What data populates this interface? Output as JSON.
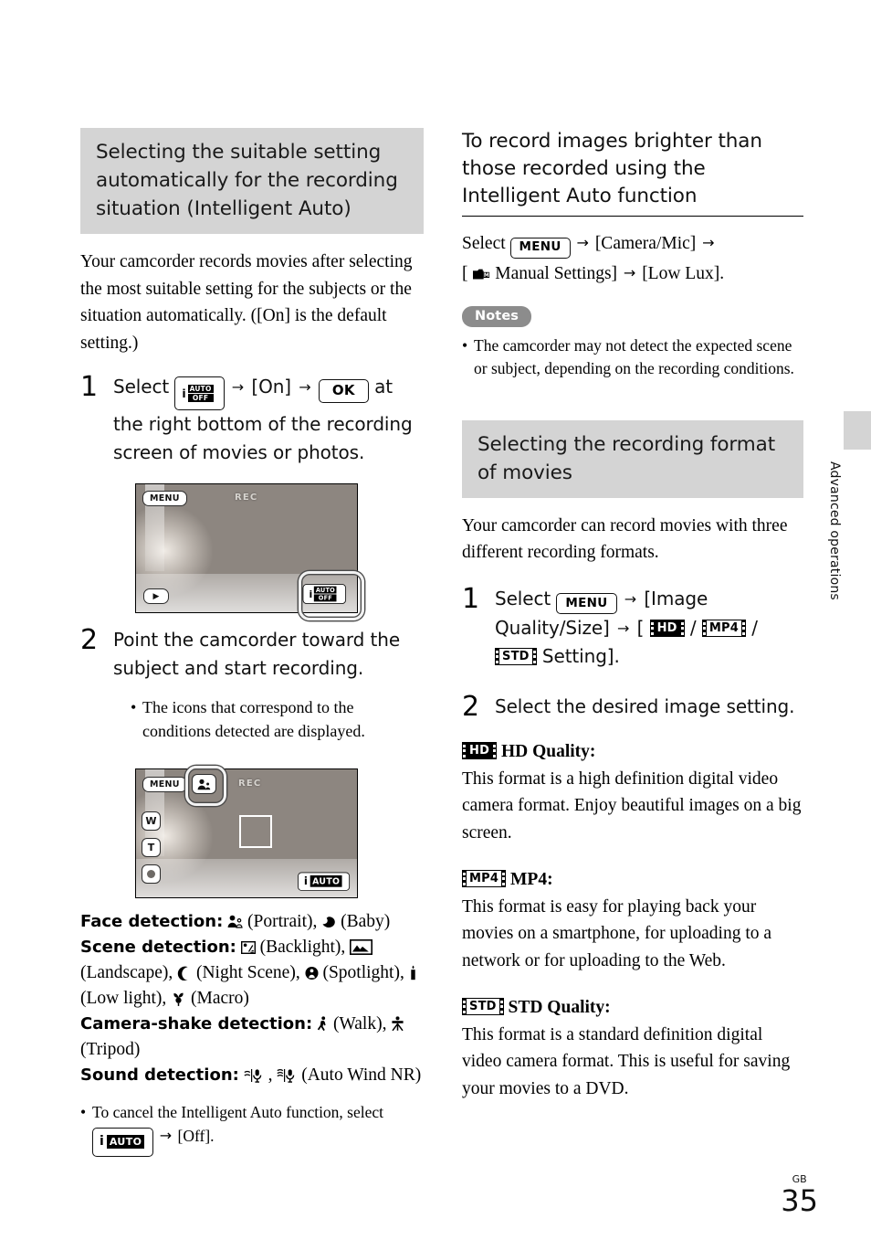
{
  "page": {
    "number": "35",
    "region_code": "GB",
    "side_tab_label": "Advanced operations"
  },
  "left_column": {
    "heading": "Selecting the suitable setting automatically for the recording situation (Intelligent Auto)",
    "intro": "Your camcorder records movies after selecting the most suitable setting for the subjects or the situation automatically. ([On] is the default setting.)",
    "step1": {
      "number": "1",
      "lead": "Select",
      "chip_iauto_off": {
        "i": "i",
        "auto": "AUTO",
        "off": "OFF"
      },
      "arrow": "→",
      "on_label": "[On]",
      "ok_label": "OK",
      "tail": "at the right bottom of the recording screen of movies or photos."
    },
    "screenshot1": {
      "menu": "MENU",
      "rec": "REC",
      "play": "▶",
      "iauto_off": {
        "i": "i",
        "auto": "AUTO",
        "off": "OFF"
      }
    },
    "step2": {
      "number": "2",
      "text": "Point the camcorder toward the subject and start recording.",
      "bullet": "The icons that correspond to the conditions detected are displayed."
    },
    "screenshot2": {
      "menu": "MENU",
      "rec": "REC",
      "zoom_wide": "W",
      "zoom_tele": "T",
      "iauto": {
        "i": "i",
        "auto": "AUTO"
      }
    },
    "detections": [
      {
        "label": "Face detection:",
        "items": "(Portrait), (Baby)",
        "icons": [
          "portrait-icon",
          "baby-icon"
        ],
        "item1": "(Portrait),",
        "item2": "(Baby)"
      },
      {
        "label": "Scene detection:",
        "item1": "(Backlight),",
        "item2": "(Landscape),",
        "item3": "(Night Scene),",
        "item4": "(Spotlight),",
        "item5": "(Low light),",
        "item6": "(Macro)"
      },
      {
        "label": "Camera-shake detection:",
        "item1": "(Walk),",
        "item2": "(Tripod)"
      },
      {
        "label": "Sound detection:",
        "item1": ",",
        "item2": "(Auto Wind NR)"
      }
    ],
    "cancel_bullet": {
      "text_before": "To cancel the Intelligent Auto function, select",
      "chip": {
        "i": "i",
        "auto": "AUTO"
      },
      "arrow": "→",
      "text_after": "[Off]."
    }
  },
  "right_column": {
    "heading_brighter": "To record images brighter than those recorded using the Intelligent Auto function",
    "brighter_steps": {
      "select": "Select",
      "menu_chip": "MENU",
      "arrow": "→",
      "item1": "[Camera/Mic]",
      "bracket_open": "[",
      "manual_icon": "M",
      "item2": "Manual Settings]",
      "item3": "[Low Lux]."
    },
    "notes": {
      "pill": "Notes",
      "bullets": [
        "The camcorder may not detect the expected scene or subject, depending on the recording conditions."
      ]
    },
    "heading_format": "Selecting the recording format of movies",
    "format_intro": "Your camcorder can record movies with three different recording formats.",
    "step1": {
      "number": "1",
      "lead": "Select",
      "menu_chip": "MENU",
      "arrow": "→",
      "item1": "[Image Quality/Size]",
      "bracket_open": "[",
      "badge_hd": "HD",
      "slash": "/",
      "badge_mp4": "MP4",
      "badge_std": "STD",
      "tail": "Setting]."
    },
    "step2": {
      "number": "2",
      "text": "Select the desired image setting."
    },
    "formats": [
      {
        "badge": "HD",
        "badge_style": "inverted",
        "title": "HD Quality:",
        "body": "This format is a high definition digital video camera format. Enjoy beautiful images on a big screen."
      },
      {
        "badge": "MP4",
        "badge_style": "outline",
        "title": "MP4:",
        "body": "This format is easy for playing back your movies on a smartphone, for uploading to a network or for uploading to the Web."
      },
      {
        "badge": "STD",
        "badge_style": "outline",
        "title": "STD Quality:",
        "body": "This format is a standard definition digital video camera format. This is useful for saving your movies to a DVD."
      }
    ]
  },
  "colors": {
    "heading_band": "#d4d4d4",
    "notes_pill": "#8c8c8c",
    "text": "#000000"
  }
}
